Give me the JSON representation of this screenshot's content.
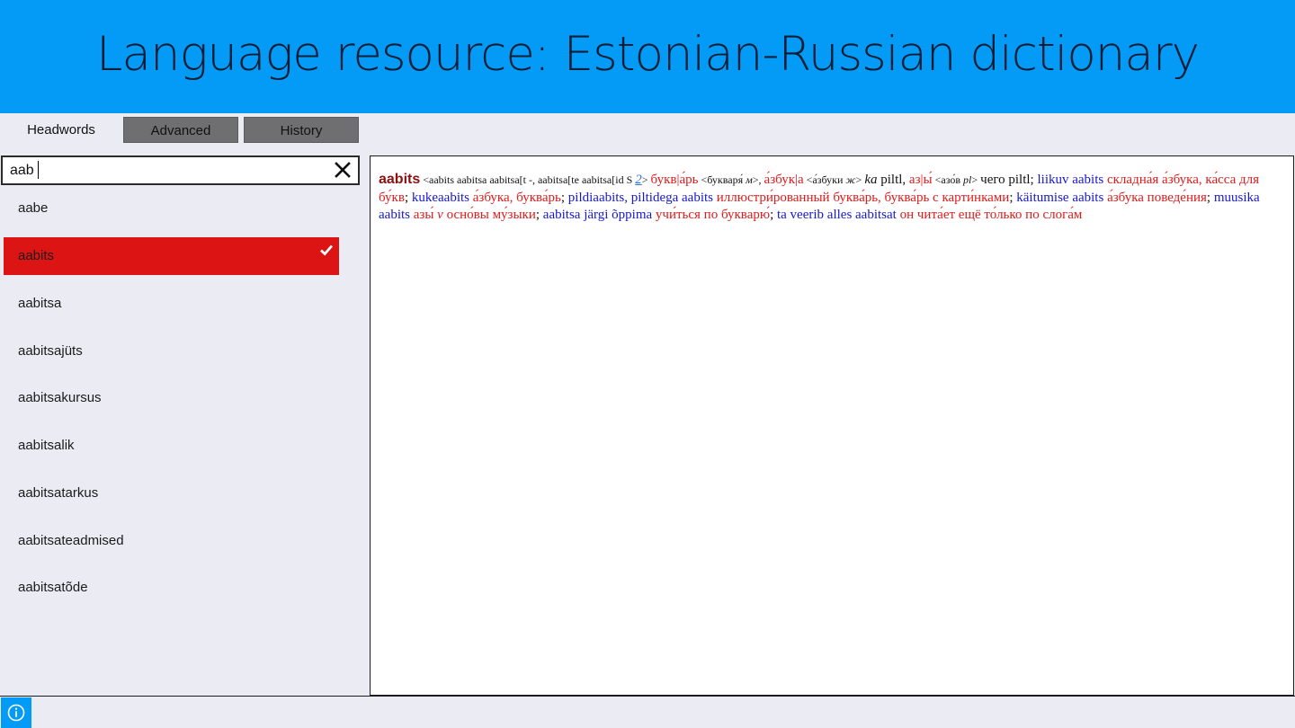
{
  "header": {
    "title": "Language resource: Estonian-Russian dictionary"
  },
  "tabs": [
    {
      "label": "Headwords"
    },
    {
      "label": "Advanced"
    },
    {
      "label": "History"
    }
  ],
  "search": {
    "value": "aab"
  },
  "headwords": [
    {
      "label": "aabe",
      "selected": false
    },
    {
      "label": "aabits",
      "selected": true
    },
    {
      "label": "aabitsa",
      "selected": false
    },
    {
      "label": "aabitsajüts",
      "selected": false
    },
    {
      "label": "aabitsakursus",
      "selected": false
    },
    {
      "label": "aabitsalik",
      "selected": false
    },
    {
      "label": "aabitsatarkus",
      "selected": false
    },
    {
      "label": "aabitsateadmised",
      "selected": false
    },
    {
      "label": "aabitsatõde",
      "selected": false
    }
  ],
  "entry": {
    "segments": [
      {
        "t": "aabits",
        "c": "hw"
      },
      {
        "t": " <aabits aabitsa aabitsa[t -, aabitsa[te aabitsa[id S ",
        "c": "gram"
      },
      {
        "t": "2",
        "c": "num"
      },
      {
        "t": "> ",
        "c": "gram"
      },
      {
        "t": "букв|а́рь",
        "c": "ru"
      },
      {
        "t": " <букваря́ ",
        "c": "gram"
      },
      {
        "t": "м",
        "c": "gram ital"
      },
      {
        "t": ">, ",
        "c": "gram"
      },
      {
        "t": "а́збук|а",
        "c": "ru"
      },
      {
        "t": " <а́збуки ",
        "c": "gram"
      },
      {
        "t": "ж",
        "c": "gram ital"
      },
      {
        "t": "> ",
        "c": "gram"
      },
      {
        "t": "ka",
        "c": "blk ital"
      },
      {
        "t": " piltl, ",
        "c": "blk"
      },
      {
        "t": "аз|ы́",
        "c": "ru"
      },
      {
        "t": " <азо́в ",
        "c": "gram"
      },
      {
        "t": "pl",
        "c": "gram ital"
      },
      {
        "t": "> ",
        "c": "gram"
      },
      {
        "t": "чего piltl; ",
        "c": "blk"
      },
      {
        "t": "liikuv aabits",
        "c": "et"
      },
      {
        "t": " складна́я а́збука, ка́сса для бу́кв",
        "c": "ru"
      },
      {
        "t": "; ",
        "c": "blk"
      },
      {
        "t": "kukeaabits",
        "c": "et"
      },
      {
        "t": " а́збука, буква́рь",
        "c": "ru"
      },
      {
        "t": "; ",
        "c": "blk"
      },
      {
        "t": "pildiaabits, piltidega aabits",
        "c": "et"
      },
      {
        "t": " иллюстри́рованный буква́рь, буква́рь с карти́нками",
        "c": "ru"
      },
      {
        "t": "; ",
        "c": "blk"
      },
      {
        "t": "käitumise aabits",
        "c": "et"
      },
      {
        "t": " а́збука поведе́ния",
        "c": "ru"
      },
      {
        "t": "; ",
        "c": "blk"
      },
      {
        "t": "muusika aabits",
        "c": "et"
      },
      {
        "t": " азы́ ",
        "c": "ru"
      },
      {
        "t": "v",
        "c": "ru ital"
      },
      {
        "t": " осно́вы му́зыки",
        "c": "ru"
      },
      {
        "t": "; ",
        "c": "blk"
      },
      {
        "t": "aabitsa järgi õppima",
        "c": "et"
      },
      {
        "t": " учи́ться по букварю́",
        "c": "ru"
      },
      {
        "t": "; ",
        "c": "blk"
      },
      {
        "t": "ta veerib alles aabitsat",
        "c": "et"
      },
      {
        "t": " он чита́ет ещё то́лько по слога́м",
        "c": "ru"
      }
    ]
  },
  "icons": {
    "clear": "close-icon",
    "check": "checkmark-icon",
    "info": "info-icon"
  },
  "colors": {
    "header_bg": "#039bf5",
    "selected_bg": "#dd1414",
    "tab_inactive_bg": "#6f6f72",
    "estonian_text": "#1717d2",
    "russian_text": "#e01b1b",
    "headword_text": "#8b1010"
  }
}
